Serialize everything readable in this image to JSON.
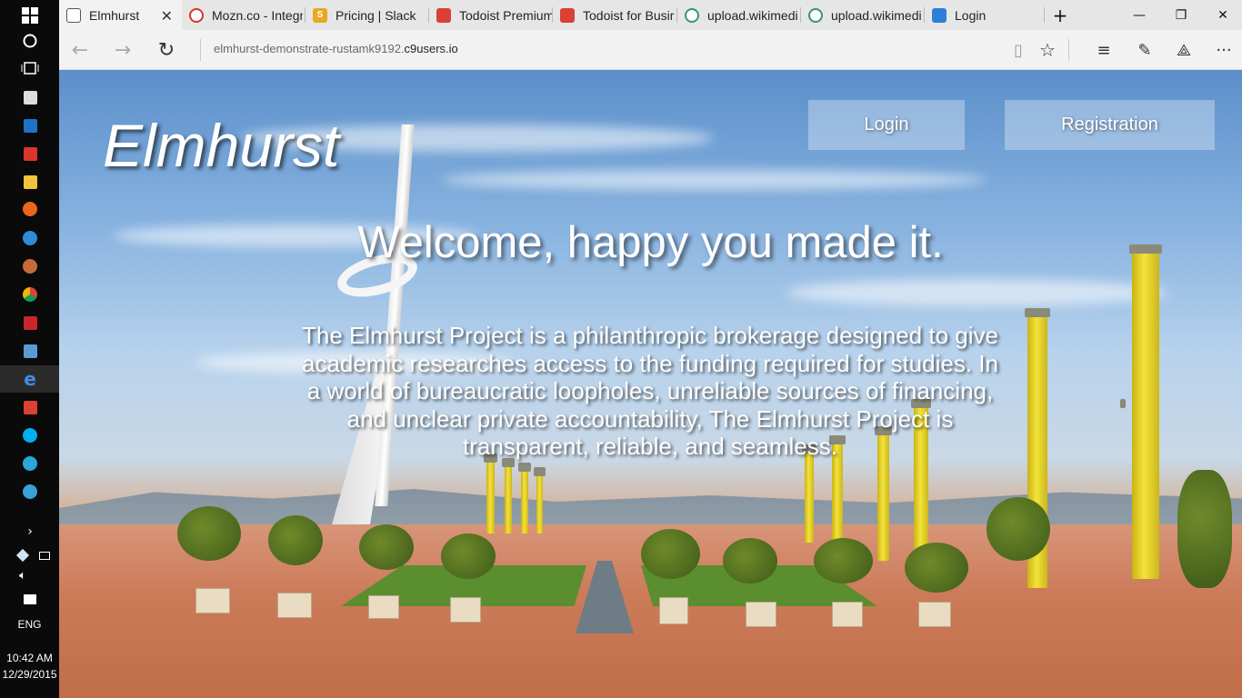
{
  "taskbar": {
    "clock_time": "10:42 AM",
    "clock_date": "12/29/2015",
    "language": "ENG",
    "icons": [
      "windows-start-icon",
      "cortana-icon",
      "task-view-icon",
      "calculator-icon",
      "calendar-icon",
      "photos-icon",
      "file-explorer-icon",
      "firefox-icon",
      "messaging-icon",
      "app-icon",
      "chrome-icon",
      "filezilla-icon",
      "app-icon",
      "edge-icon",
      "todoist-icon",
      "skype-icon",
      "app-icon",
      "media-icon"
    ]
  },
  "browser": {
    "tabs": [
      {
        "label": "Elmhurst",
        "favicon": "page-icon",
        "active": true
      },
      {
        "label": "Mozn.co - Integr",
        "favicon": "mozn-icon"
      },
      {
        "label": "Pricing | Slack",
        "favicon": "slack-icon"
      },
      {
        "label": "Todoist Premium",
        "favicon": "todoist-icon"
      },
      {
        "label": "Todoist for Busir",
        "favicon": "todoist-icon"
      },
      {
        "label": "upload.wikimedi",
        "favicon": "wikimedia-icon"
      },
      {
        "label": "upload.wikimedi",
        "favicon": "wikimedia-icon"
      },
      {
        "label": "Login",
        "favicon": "login-icon"
      }
    ],
    "url_prefix": "elmhurst-demonstrate-rustamk9192.",
    "url_domain": "c9users.io"
  },
  "site": {
    "brand": "Elmhurst",
    "nav": {
      "login": "Login",
      "registration": "Registration"
    },
    "headline": "Welcome, happy you made it.",
    "description": "The Elmhurst Project is a philanthropic brokerage designed to give academic researches access to the funding required for studies. In a world of bureaucratic loopholes, unreliable sources of financing, and unclear private accountability, The Elmhurst Project is transparent, reliable, and seamless."
  },
  "colors": {
    "taskbar_bg": "#0a0a0a",
    "tabstrip_bg": "#e6e6e6",
    "navbar_bg": "#f2f2f2",
    "overlay_button_bg": "rgba(255,255,255,0.32)",
    "headline_color": "#ffffff"
  }
}
